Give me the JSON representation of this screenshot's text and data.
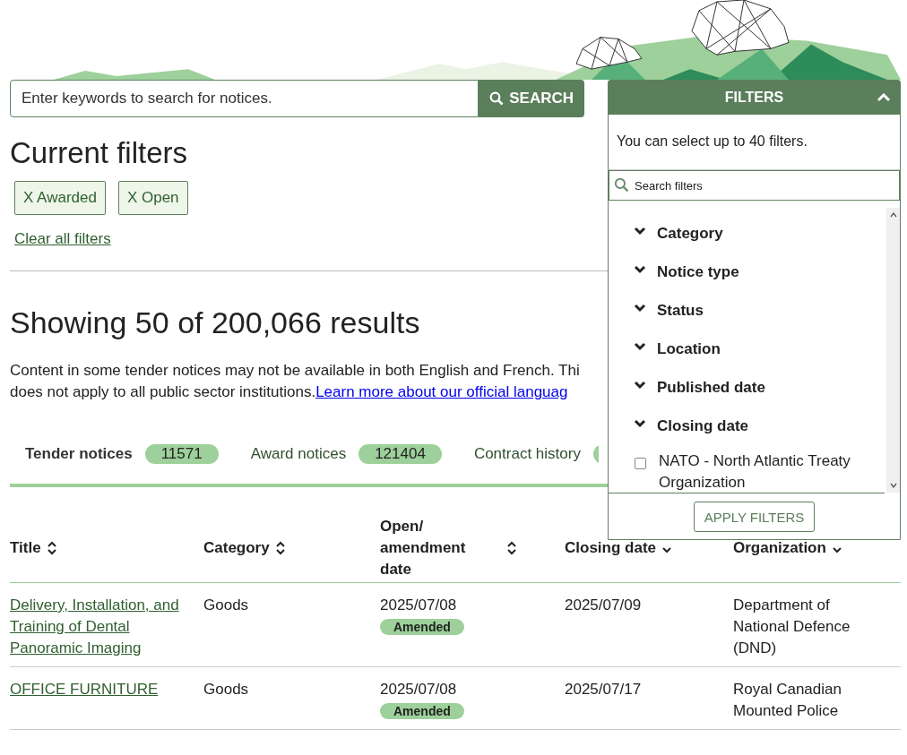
{
  "search": {
    "placeholder": "Enter keywords to search for notices.",
    "button": "SEARCH"
  },
  "current_filters": {
    "heading": "Current filters",
    "chips": [
      {
        "label": "X Awarded"
      },
      {
        "label": "X Open"
      }
    ],
    "clear_link": "Clear all filters"
  },
  "results": {
    "heading": "Showing 50 of 200,066 results",
    "notice_line_1": "Content in some tender notices may not be available in both English and French. Thi",
    "notice_line_2": "does not apply to all public sector institutions.",
    "notice_link": "Learn more about our official languag"
  },
  "tabs": [
    {
      "label": "Tender notices",
      "count": "11571",
      "selected": true
    },
    {
      "label": "Award notices",
      "count": "121404",
      "selected": false
    },
    {
      "label": "Contract history",
      "selected": false
    }
  ],
  "table": {
    "columns": [
      {
        "label": "Title",
        "kind": "sortable"
      },
      {
        "label": "Category",
        "kind": "sortable"
      },
      {
        "label": "Open/ amendment date",
        "kind": "sortable"
      },
      {
        "label": "Closing date",
        "kind": "sorted"
      },
      {
        "label": "Organization",
        "kind": "sorted"
      }
    ],
    "rows": [
      {
        "title": "Delivery, Installation, and Training of Dental Panoramic Imaging",
        "category": "Goods",
        "open_date": "2025/07/08",
        "badge": "Amended",
        "closing_date": "2025/07/09",
        "organization": "Department of National Defence (DND)"
      },
      {
        "title": "OFFICE FURNITURE",
        "category": "Goods",
        "open_date": "2025/07/08",
        "badge": "Amended",
        "closing_date": "2025/07/17",
        "organization": "Royal Canadian Mounted Police"
      }
    ]
  },
  "filters_panel": {
    "title": "FILTERS",
    "expanded": true,
    "hint": "You can select up to 40 filters.",
    "search_placeholder": "Search filters",
    "apply_button": "APPLY FILTERS",
    "items": [
      {
        "kind": "group",
        "label": "Category",
        "expanded": false
      },
      {
        "kind": "group",
        "label": "Notice type",
        "expanded": false
      },
      {
        "kind": "group",
        "label": "Status",
        "expanded": false
      },
      {
        "kind": "group",
        "label": "Location",
        "expanded": false
      },
      {
        "kind": "group",
        "label": "Published date",
        "expanded": false
      },
      {
        "kind": "group",
        "label": "Closing date",
        "expanded": false
      },
      {
        "kind": "option",
        "label": "NATO - North Atlantic Treaty Organization",
        "checked": false
      }
    ]
  }
}
